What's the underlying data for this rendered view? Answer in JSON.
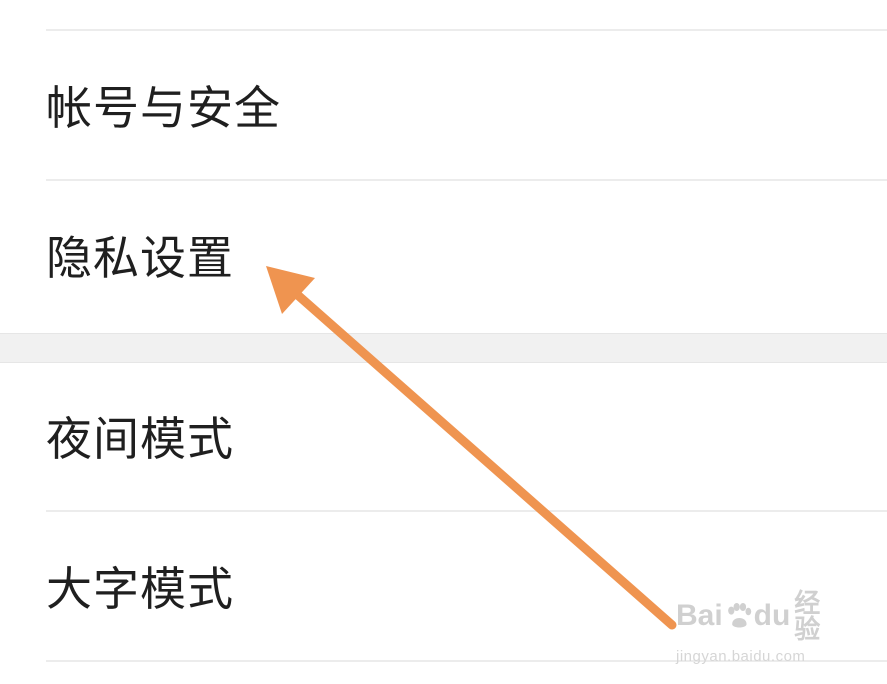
{
  "settings": {
    "items": [
      {
        "label": "帐号与安全"
      },
      {
        "label": "隐私设置"
      },
      {
        "label": "夜间模式"
      },
      {
        "label": "大字模式"
      }
    ]
  },
  "annotation": {
    "arrow_icon": "arrow-pointing-icon",
    "arrow_color": "#EF9450"
  },
  "watermark": {
    "brand_left": "Bai",
    "brand_right": "du",
    "brand_cn": "经验",
    "url": "jingyan.baidu.com"
  }
}
